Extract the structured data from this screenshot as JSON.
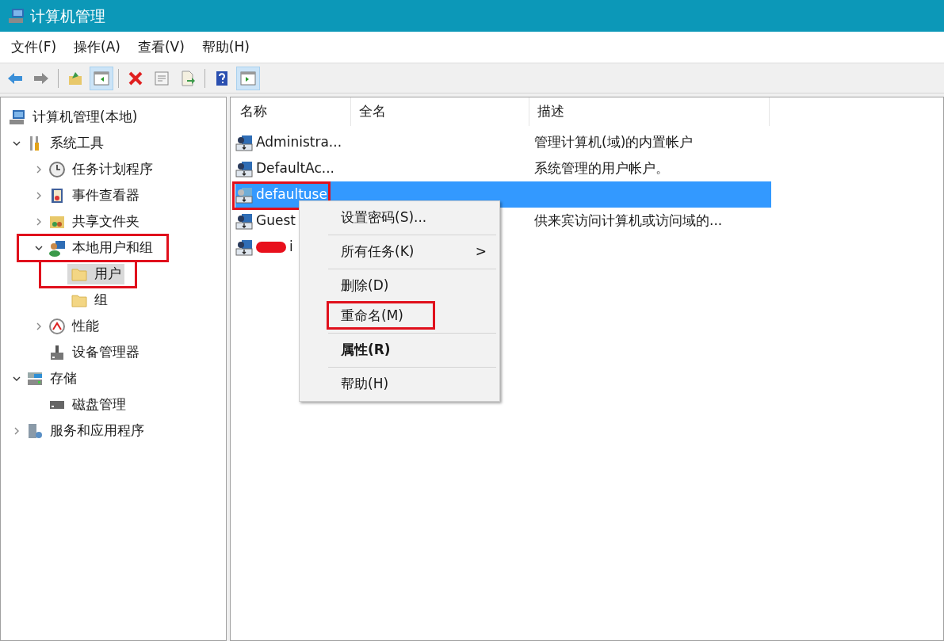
{
  "window": {
    "title": "计算机管理"
  },
  "menu": [
    "文件(F)",
    "操作(A)",
    "查看(V)",
    "帮助(H)"
  ],
  "toolbar": [
    {
      "kind": "back",
      "pressed": false
    },
    {
      "kind": "forward",
      "pressed": false
    },
    {
      "kind": "separator"
    },
    {
      "kind": "up",
      "pressed": false
    },
    {
      "kind": "tree",
      "pressed": true
    },
    {
      "kind": "separator"
    },
    {
      "kind": "delete",
      "pressed": false
    },
    {
      "kind": "properties",
      "pressed": false
    },
    {
      "kind": "export",
      "pressed": false
    },
    {
      "kind": "separator"
    },
    {
      "kind": "help",
      "pressed": false
    },
    {
      "kind": "action",
      "pressed": true
    }
  ],
  "tree": [
    {
      "label": "计算机管理(本地)",
      "kind": "computer",
      "selected": false,
      "highlighted": false,
      "children": [
        {
          "label": "系统工具",
          "kind": "tools",
          "expanded": true,
          "selected": false,
          "highlighted": false,
          "children": [
            {
              "label": "任务计划程序",
              "kind": "clock",
              "expanded": false,
              "selected": false,
              "highlighted": false
            },
            {
              "label": "事件查看器",
              "kind": "log",
              "expanded": false,
              "selected": false,
              "highlighted": false
            },
            {
              "label": "共享文件夹",
              "kind": "share",
              "expanded": false,
              "selected": false,
              "highlighted": false
            },
            {
              "label": "本地用户和组",
              "kind": "users",
              "expanded": true,
              "selected": false,
              "highlighted": true,
              "children": [
                {
                  "label": "用户",
                  "kind": "folder",
                  "selected": true,
                  "highlighted": true
                },
                {
                  "label": "组",
                  "kind": "folder",
                  "selected": false,
                  "highlighted": false
                }
              ]
            },
            {
              "label": "性能",
              "kind": "performance",
              "expanded": false,
              "selected": false,
              "highlighted": false
            },
            {
              "label": "设备管理器",
              "kind": "device",
              "selected": false,
              "highlighted": false
            }
          ]
        },
        {
          "label": "存储",
          "kind": "storage",
          "expanded": true,
          "selected": false,
          "highlighted": false,
          "children": [
            {
              "label": "磁盘管理",
              "kind": "disk",
              "selected": false,
              "highlighted": false
            }
          ]
        },
        {
          "label": "服务和应用程序",
          "kind": "services",
          "expanded": false,
          "selected": false,
          "highlighted": false
        }
      ]
    }
  ],
  "table": {
    "columns": [
      "名称",
      "全名",
      "描述"
    ],
    "rows": [
      {
        "name": "Administra...",
        "full_name": "",
        "description": "管理计算机(域)的内置帐户",
        "selected": false,
        "disabled": false,
        "highlighted": false,
        "redacted": false
      },
      {
        "name": "DefaultAc...",
        "full_name": "",
        "description": "系统管理的用户帐户。",
        "selected": false,
        "disabled": false,
        "highlighted": false,
        "redacted": false
      },
      {
        "name": "defaultuse",
        "full_name": "",
        "description": "",
        "selected": true,
        "disabled": true,
        "highlighted": true,
        "redacted": false
      },
      {
        "name": "Guest",
        "full_name": "",
        "description": "供来宾访问计算机或访问域的...",
        "selected": false,
        "disabled": false,
        "highlighted": false,
        "redacted": false
      },
      {
        "name": "i",
        "full_name": "",
        "description": "",
        "selected": false,
        "disabled": false,
        "highlighted": false,
        "redacted": true
      }
    ]
  },
  "context_menu": [
    {
      "kind": "item",
      "label": "设置密码(S)...",
      "bold": false,
      "submenu": false,
      "highlighted": false
    },
    {
      "kind": "separator"
    },
    {
      "kind": "item",
      "label": "所有任务(K)",
      "bold": false,
      "submenu": true,
      "highlighted": false
    },
    {
      "kind": "separator"
    },
    {
      "kind": "item",
      "label": "删除(D)",
      "bold": false,
      "submenu": false,
      "highlighted": false
    },
    {
      "kind": "item",
      "label": "重命名(M)",
      "bold": false,
      "submenu": false,
      "highlighted": true
    },
    {
      "kind": "separator"
    },
    {
      "kind": "item",
      "label": "属性(R)",
      "bold": true,
      "submenu": false,
      "highlighted": false
    },
    {
      "kind": "separator"
    },
    {
      "kind": "item",
      "label": "帮助(H)",
      "bold": false,
      "submenu": false,
      "highlighted": false
    }
  ],
  "submenu_glyph": ">"
}
